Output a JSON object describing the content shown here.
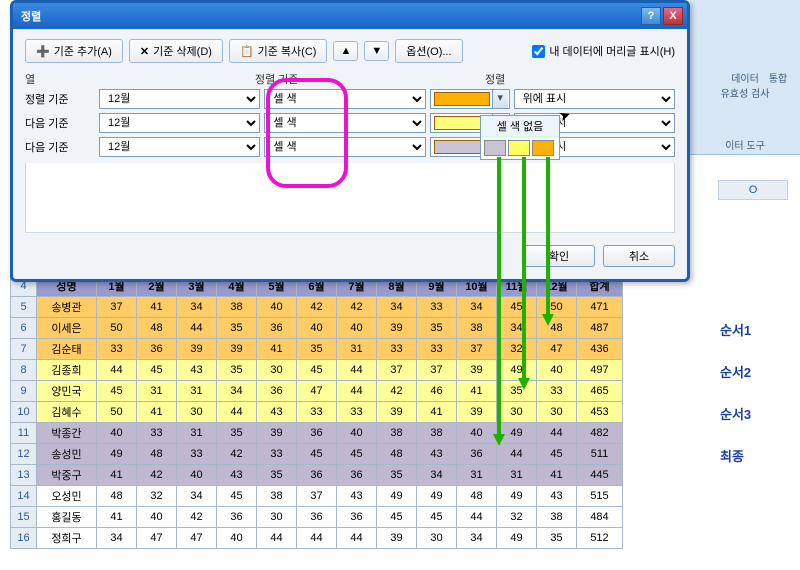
{
  "dialog": {
    "title": "정렬",
    "help_icon": "?",
    "close_icon": "X",
    "buttons": {
      "add": "기준 추가(A)",
      "delete": "기준 삭제(D)",
      "copy": "기준 복사(C)",
      "options": "옵션(O)...",
      "header_checkbox": "내 데이터에 머리글 표시(H)"
    },
    "col_headers": {
      "col": "열",
      "basis": "정렬 기준",
      "order": "정렬"
    },
    "rows": [
      {
        "label": "정렬 기준",
        "col": "12월",
        "basis": "셀 색",
        "color": "orange",
        "order": "위에 표시"
      },
      {
        "label": "다음 기준",
        "col": "12월",
        "basis": "셀 색",
        "color": "yellow",
        "order": "위에 표시"
      },
      {
        "label": "다음 기준",
        "col": "12월",
        "basis": "셀 색",
        "color": "grey",
        "order": "위에 표시"
      }
    ],
    "dropdown": {
      "no_color": "셀 색 없음"
    },
    "footer": {
      "ok": "확인",
      "cancel": "취소"
    }
  },
  "ribbon": {
    "data": "데이터",
    "validation": "유효성 검사",
    "consolidation": "통합",
    "tools": "이터 도구"
  },
  "sheet": {
    "col_letter": "O",
    "row_start": 4,
    "headers": [
      "성명",
      "1월",
      "2월",
      "3월",
      "4월",
      "5월",
      "6월",
      "7월",
      "8월",
      "9월",
      "10월",
      "11월",
      "12월",
      "합계"
    ],
    "rows": [
      {
        "c": "orange",
        "v": [
          "송병관",
          37,
          41,
          34,
          38,
          40,
          42,
          42,
          34,
          33,
          34,
          45,
          50,
          471
        ]
      },
      {
        "c": "orange",
        "v": [
          "이세은",
          50,
          48,
          44,
          35,
          36,
          40,
          40,
          39,
          35,
          38,
          34,
          48,
          487
        ]
      },
      {
        "c": "orange",
        "v": [
          "김순태",
          33,
          36,
          39,
          39,
          41,
          35,
          31,
          33,
          33,
          37,
          32,
          47,
          436
        ]
      },
      {
        "c": "yellow",
        "v": [
          "김종희",
          44,
          45,
          43,
          35,
          30,
          45,
          44,
          37,
          37,
          39,
          49,
          40,
          497
        ]
      },
      {
        "c": "yellow",
        "v": [
          "양민국",
          45,
          31,
          31,
          34,
          36,
          47,
          44,
          42,
          46,
          41,
          35,
          33,
          465
        ]
      },
      {
        "c": "yellow",
        "v": [
          "김혜수",
          50,
          41,
          30,
          44,
          43,
          33,
          33,
          39,
          41,
          39,
          30,
          30,
          453
        ]
      },
      {
        "c": "grey",
        "v": [
          "박종간",
          40,
          33,
          31,
          35,
          39,
          36,
          40,
          38,
          38,
          40,
          49,
          44,
          482
        ]
      },
      {
        "c": "grey",
        "v": [
          "송성민",
          49,
          48,
          33,
          42,
          33,
          45,
          45,
          48,
          43,
          36,
          44,
          45,
          511
        ]
      },
      {
        "c": "grey",
        "v": [
          "박중구",
          41,
          42,
          40,
          43,
          35,
          36,
          36,
          35,
          34,
          31,
          31,
          41,
          445
        ]
      },
      {
        "c": "white",
        "v": [
          "오성민",
          48,
          32,
          34,
          45,
          38,
          37,
          43,
          49,
          49,
          48,
          49,
          43,
          515
        ]
      },
      {
        "c": "white",
        "v": [
          "홍길동",
          41,
          40,
          42,
          36,
          30,
          36,
          36,
          45,
          45,
          44,
          32,
          38,
          484
        ]
      },
      {
        "c": "white",
        "v": [
          "정희구",
          34,
          47,
          47,
          40,
          44,
          44,
          44,
          39,
          30,
          34,
          49,
          35,
          512
        ]
      }
    ]
  },
  "labels": {
    "order1": "순서1",
    "order2": "순서2",
    "order3": "순서3",
    "final": "최종"
  }
}
